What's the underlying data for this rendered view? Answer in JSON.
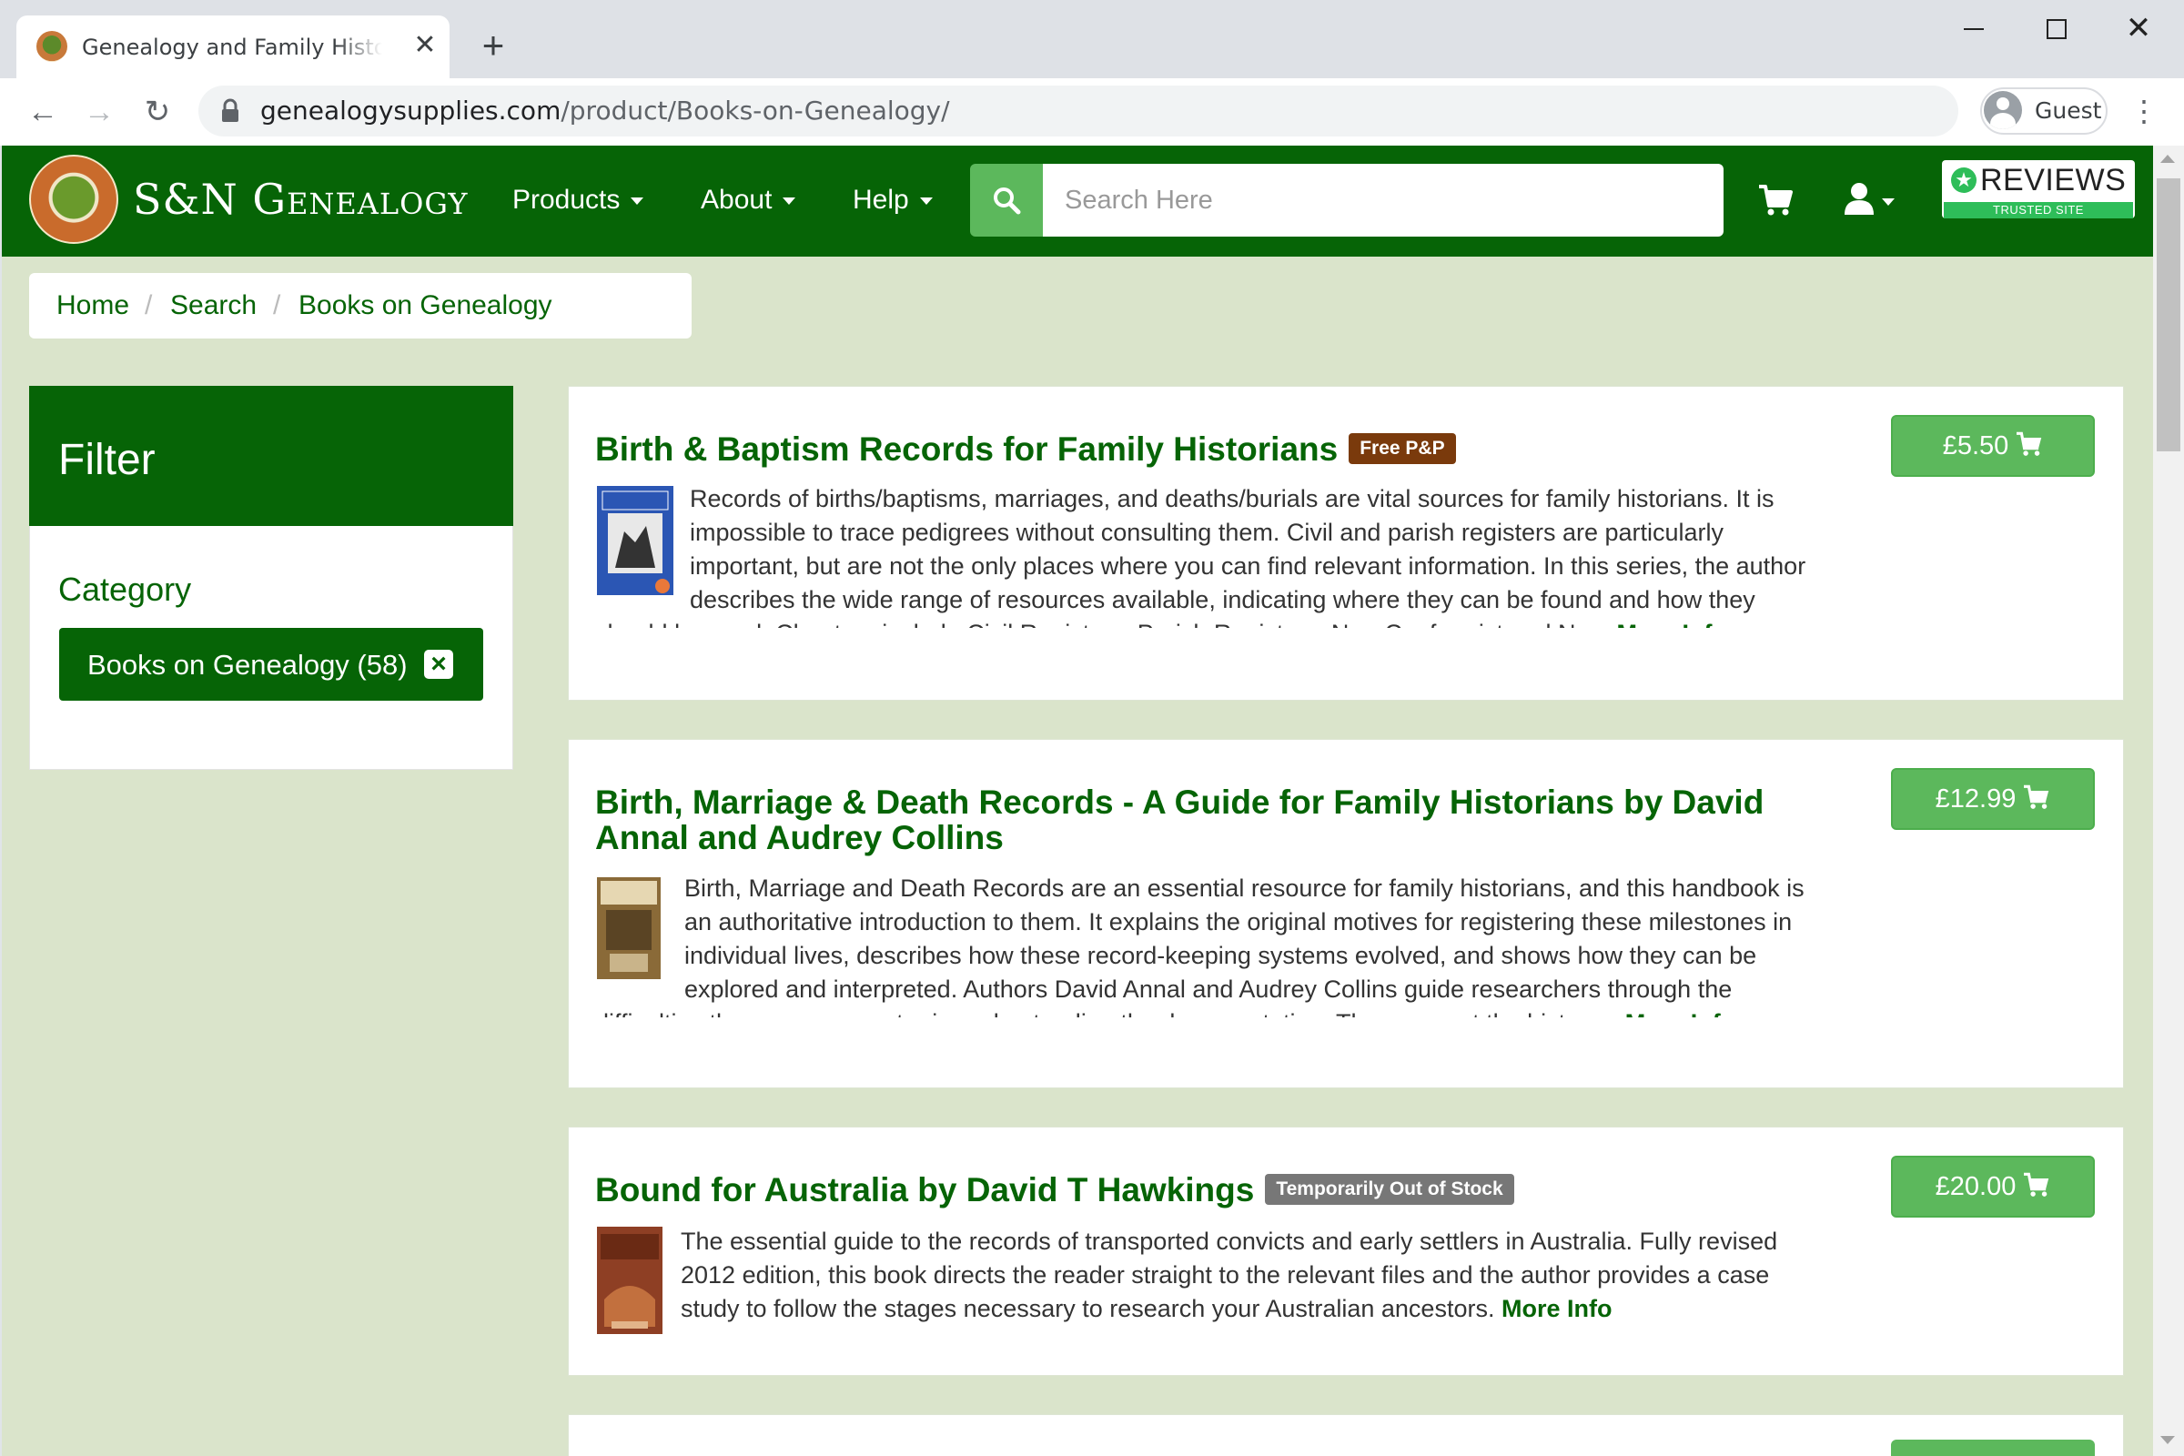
{
  "browser": {
    "tab_title": "Genealogy and Family History Products",
    "tab_close": "✕",
    "new_tab": "+",
    "url_host": "genealogysupplies.com",
    "url_path": "/product/Books-on-Genealogy/",
    "profile_label": "Guest"
  },
  "site": {
    "logo_text": "S&N Genealogy",
    "nav": [
      "Products",
      "About",
      "Help"
    ],
    "search_placeholder": "Search Here",
    "reviews_text": "REVIEWS",
    "reviews_sub": "TRUSTED SITE",
    "brand_color": "#066406",
    "accent_color": "#5cb85c"
  },
  "breadcrumb": [
    "Home",
    "Search",
    "Books on Genealogy"
  ],
  "filter": {
    "title": "Filter",
    "category_label": "Category",
    "selected_category": "Books on Genealogy (58)"
  },
  "products": [
    {
      "title": "Birth & Baptism Records for Family Historians",
      "badge": "Free P&P",
      "price": "£5.50",
      "description": "Records of births/baptisms, marriages, and deaths/burials are vital sources for family historians. It is impossible to trace pedigrees without consulting them. Civil and parish registers are particularly important, but are not the only places where you can find relevant information. In this series, the author describes the wide range of resources available, indicating where they can be found and how they should be used. Chapters include Civil Registers, Parish Registers, Non-Conformist and No...",
      "more": "More Info"
    },
    {
      "title": "Birth, Marriage & Death Records - A Guide for Family Historians by David Annal and Audrey Collins",
      "badge": "",
      "price": "£12.99",
      "description": "Birth, Marriage and Death Records are an essential resource for family historians, and this handbook is an authoritative introduction to them. It explains the original motives for registering these milestones in individual lives, describes how these record-keeping systems evolved, and shows how they can be explored and interpreted. Authors David Annal and Audrey Collins guide researchers through the difficulties they may encounter in understanding the documentation. They recount the history...",
      "more": "More Info"
    },
    {
      "title": "Bound for Australia by David T Hawkings",
      "badge": "Temporarily Out of Stock",
      "price": "£20.00",
      "description": "The essential guide to the records of transported convicts and early settlers in Australia. Fully revised 2012 edition, this book directs the reader straight to the relevant files and the author provides a case study to follow the stages necessary to research your Australian ancestors.",
      "more": "More Info"
    }
  ]
}
